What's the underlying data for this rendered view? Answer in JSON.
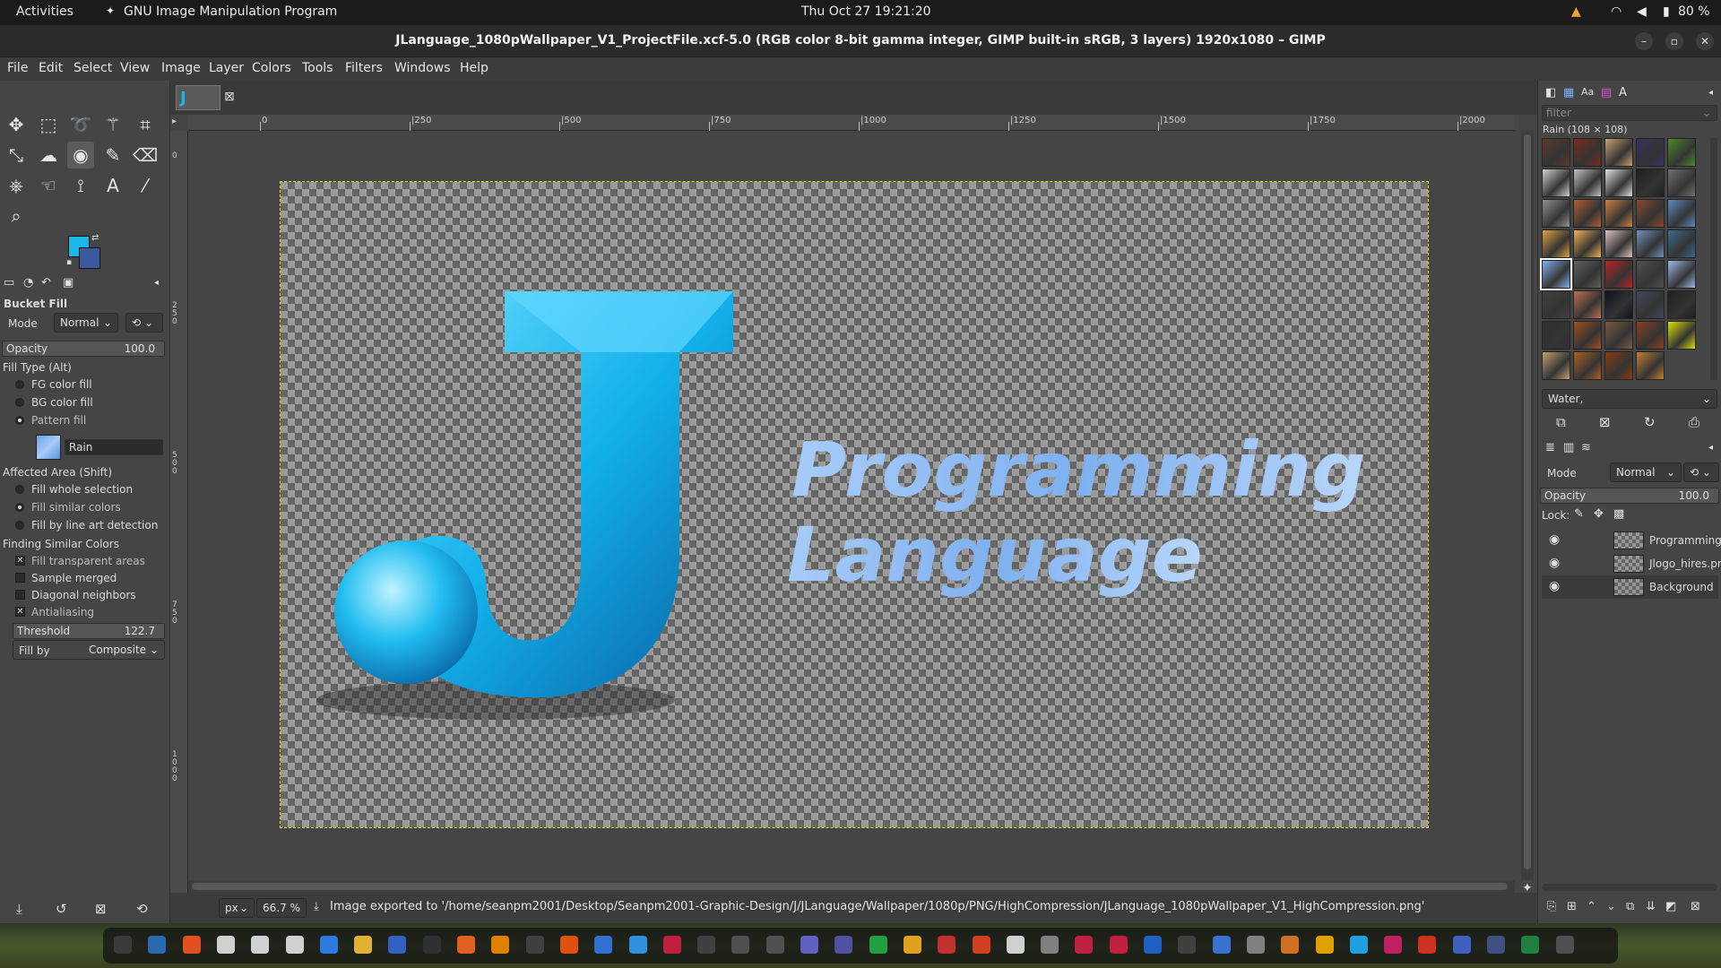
{
  "system_bar": {
    "activities": "Activities",
    "app_name": "GNU Image Manipulation Program",
    "clock": "Thu Oct 27  19:21:20",
    "battery": "80 %"
  },
  "window": {
    "title": "JLanguage_1080pWallpaper_V1_ProjectFile.xcf-5.0 (RGB color 8-bit gamma integer, GIMP built-in sRGB, 3 layers) 1920x1080 – GIMP"
  },
  "menu": [
    "File",
    "Edit",
    "Select",
    "View",
    "Image",
    "Layer",
    "Colors",
    "Tools",
    "Filters",
    "Windows",
    "Help"
  ],
  "colors": {
    "fg": "#1ab8e8",
    "bg": "#3a5aa0",
    "accent_text": "#8fb8f2",
    "j_blue": "#19b5ea"
  },
  "tool_options": {
    "title": "Bucket Fill",
    "mode_label": "Mode",
    "mode_value": "Normal",
    "opacity_label": "Opacity",
    "opacity_value": "100.0",
    "fill_type_label": "Fill Type  (Alt)",
    "fill_types": [
      "FG color fill",
      "BG color fill",
      "Pattern fill"
    ],
    "selected_fill_type": "Pattern fill",
    "pattern_name": "Rain",
    "affected_area_label": "Affected Area  (Shift)",
    "affected_areas": [
      "Fill whole selection",
      "Fill similar colors",
      "Fill by line art detection"
    ],
    "selected_area": "Fill similar colors",
    "finding_label": "Finding Similar Colors",
    "checks": [
      {
        "label": "Fill transparent areas",
        "checked": true
      },
      {
        "label": "Sample merged",
        "checked": false
      },
      {
        "label": "Diagonal neighbors",
        "checked": false
      },
      {
        "label": "Antialiasing",
        "checked": true
      }
    ],
    "threshold_label": "Threshold",
    "threshold_value": "122.7",
    "fill_by_label": "Fill by",
    "fill_by_value": "Composite"
  },
  "ruler": {
    "h_labels": [
      "0",
      "|250",
      "|500",
      "|750",
      "|1000",
      "|1250",
      "|1500",
      "|1750",
      "|2000"
    ],
    "v_labels": [
      "0",
      "2 5 0",
      "5 0 0",
      "7 5 0",
      "1 0 0 0"
    ]
  },
  "canvas": {
    "letter": "J",
    "text_line1": "Programming",
    "text_line2": "Language"
  },
  "status": {
    "unit": "px",
    "zoom": "66.7 %",
    "message": "Image exported to '/home/seanpm2001/Desktop/Seanpm2001-Graphic-Design/J/JLanguage/Wallpaper/1080p/PNG/HighCompression/JLanguage_1080pWallpaper_V1_HighCompression.png'"
  },
  "patterns": {
    "filter_placeholder": "filter",
    "header": "Rain (108 × 108)",
    "selected_name": "Water,",
    "swatch_colors": [
      "#5a3a2a",
      "#7a2a1a",
      "#c8a070",
      "#3a3060",
      "#4a8a2a",
      "#d0d0d0",
      "#c0c0c0",
      "#e0e0e0",
      "#202020",
      "#707070",
      "#909090",
      "#b06030",
      "#d08040",
      "#8a4a2a",
      "#5a8ac0",
      "#e0a040",
      "#f0b050",
      "#e0c0c0",
      "#7090c0",
      "#3a6a90",
      "#80b0f0",
      "#606060",
      "#c02020",
      "#505050",
      "#a0b8e8",
      "#404040",
      "#c07050",
      "#101020",
      "#404858",
      "#202020",
      "#303030",
      "#a05020",
      "#7a5a40",
      "#8a4020",
      "#e0e000",
      "#c0a070",
      "#b06020",
      "#8a3a10",
      "#c08030"
    ]
  },
  "layers": {
    "mode_label": "Mode",
    "mode_value": "Normal",
    "opacity_label": "Opacity",
    "opacity_value": "100.0",
    "lock_label": "Lock:",
    "items": [
      {
        "name": "Programming",
        "selected": false
      },
      {
        "name": "Jlogo_hires.pn",
        "selected": false
      },
      {
        "name": "Background",
        "selected": true
      }
    ]
  }
}
